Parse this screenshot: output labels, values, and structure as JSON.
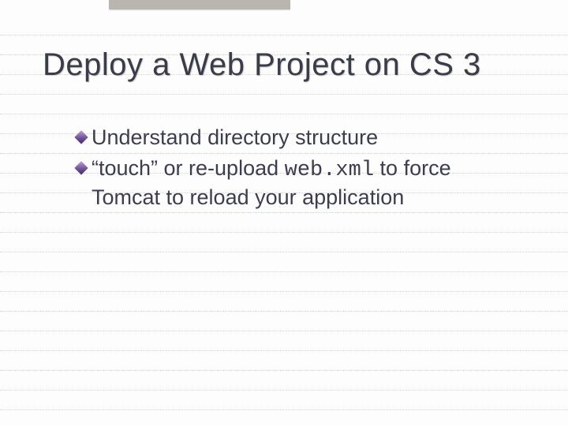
{
  "title": "Deploy a Web Project on CS 3",
  "bullets": [
    {
      "text_pre": "Understand directory structure",
      "code": "",
      "text_post": ""
    },
    {
      "text_pre": "“touch” or re-upload ",
      "code": "web.xml",
      "text_post": " to force Tomcat to reload your application"
    }
  ]
}
